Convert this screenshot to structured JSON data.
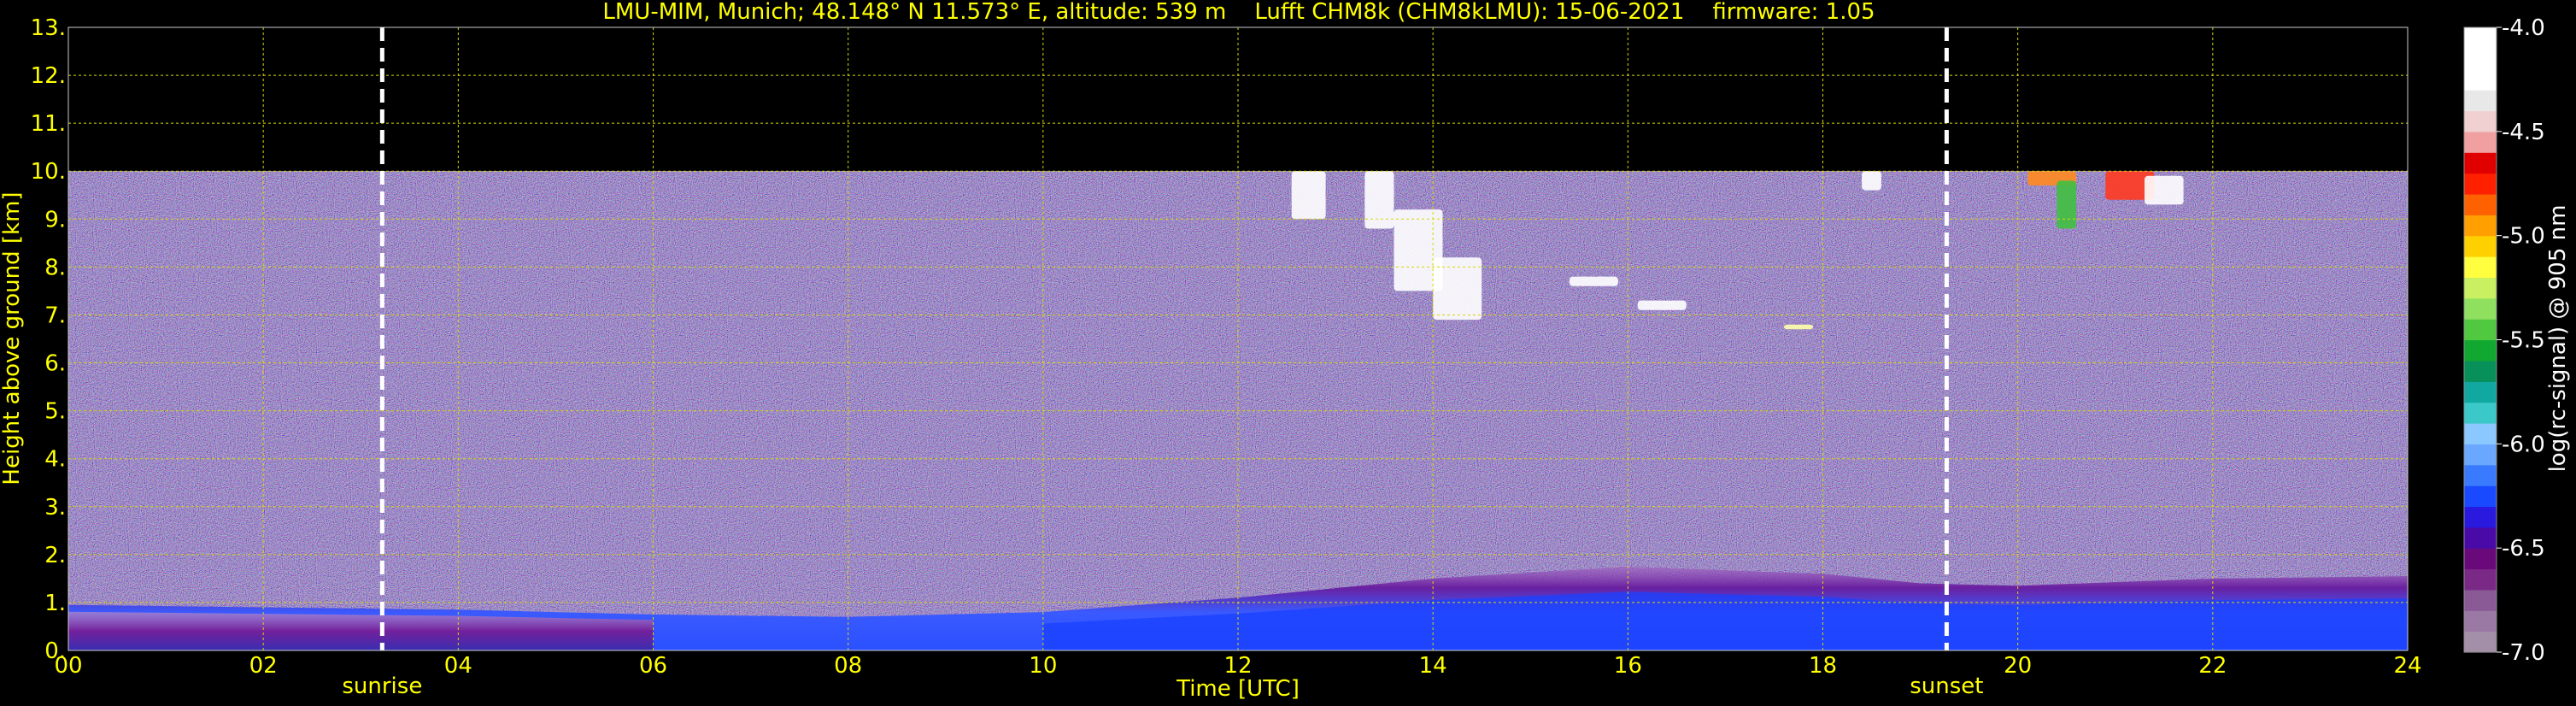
{
  "chart_data": {
    "type": "heatmap",
    "title": "LMU-MIM, Munich; 48.148° N 11.573° E, altitude: 539 m    Lufft CHM8k (CHM8kLMU): 15-06-2021    firmware: 1.05",
    "xlabel": "Time [UTC]",
    "ylabel": "Height above ground [km]",
    "xlim": [
      0,
      24
    ],
    "ylim": [
      0,
      13
    ],
    "x_ticks": [
      {
        "value": 0,
        "label": "00"
      },
      {
        "value": 2,
        "label": "02"
      },
      {
        "value": 4,
        "label": "04"
      },
      {
        "value": 6,
        "label": "06"
      },
      {
        "value": 8,
        "label": "08"
      },
      {
        "value": 10,
        "label": "10"
      },
      {
        "value": 12,
        "label": "12"
      },
      {
        "value": 14,
        "label": "14"
      },
      {
        "value": 16,
        "label": "16"
      },
      {
        "value": 18,
        "label": "18"
      },
      {
        "value": 20,
        "label": "20"
      },
      {
        "value": 22,
        "label": "22"
      },
      {
        "value": 24,
        "label": "24"
      }
    ],
    "y_ticks": [
      {
        "value": 0,
        "label": "0."
      },
      {
        "value": 1,
        "label": "1."
      },
      {
        "value": 2,
        "label": "2."
      },
      {
        "value": 3,
        "label": "3."
      },
      {
        "value": 4,
        "label": "4."
      },
      {
        "value": 5,
        "label": "5."
      },
      {
        "value": 6,
        "label": "6."
      },
      {
        "value": 7,
        "label": "7."
      },
      {
        "value": 8,
        "label": "8."
      },
      {
        "value": 9,
        "label": "9."
      },
      {
        "value": 10,
        "label": "10."
      },
      {
        "value": 11,
        "label": "11."
      },
      {
        "value": 12,
        "label": "12."
      },
      {
        "value": 13,
        "label": "13."
      }
    ],
    "grid": true,
    "data_top_km": 10,
    "events": [
      {
        "label": "sunrise",
        "time": 3.22
      },
      {
        "label": "sunset",
        "time": 19.27
      }
    ],
    "colorbar": {
      "label": "log(rc-signal) @ 905 nm",
      "range": [
        -7.0,
        -4.0
      ],
      "ticks": [
        {
          "value": -4.0,
          "label": "-4.0"
        },
        {
          "value": -4.5,
          "label": "-4.5"
        },
        {
          "value": -5.0,
          "label": "-5.0"
        },
        {
          "value": -5.5,
          "label": "-5.5"
        },
        {
          "value": -6.0,
          "label": "-6.0"
        },
        {
          "value": -6.5,
          "label": "-6.5"
        },
        {
          "value": -7.0,
          "label": "-7.0"
        }
      ],
      "colors": [
        "#a48fa8",
        "#9a7aa4",
        "#8a5a96",
        "#7a2a86",
        "#6a0a7a",
        "#4a0aa8",
        "#2a1ae0",
        "#1a4aff",
        "#3a7aff",
        "#6aa8ff",
        "#8ac8ff",
        "#3ac8c8",
        "#10a8a0",
        "#08905a",
        "#10a830",
        "#50c840",
        "#90e060",
        "#c8f060",
        "#ffff40",
        "#ffd000",
        "#ffa000",
        "#ff6000",
        "#ff2000",
        "#e00000",
        "#f0a0a0",
        "#f0d0d0",
        "#e8e8e8",
        "#ffffff",
        "#ffffff",
        "#ffffff"
      ]
    },
    "boundary_layer_top_km": [
      {
        "time": 0,
        "value": 0.95
      },
      {
        "time": 2,
        "value": 0.9
      },
      {
        "time": 4,
        "value": 0.85
      },
      {
        "time": 6,
        "value": 0.75
      },
      {
        "time": 8,
        "value": 0.7
      },
      {
        "time": 10,
        "value": 0.8
      },
      {
        "time": 12,
        "value": 1.1
      },
      {
        "time": 14,
        "value": 1.5
      },
      {
        "time": 16,
        "value": 1.75
      },
      {
        "time": 18,
        "value": 1.6
      },
      {
        "time": 19,
        "value": 1.4
      },
      {
        "time": 20,
        "value": 1.35
      },
      {
        "time": 22,
        "value": 1.5
      },
      {
        "time": 24,
        "value": 1.55
      }
    ],
    "cloud_features": [
      {
        "t0": 12.55,
        "t1": 12.9,
        "h0": 9.0,
        "h1": 10.0,
        "color": "#ffffff"
      },
      {
        "t0": 13.3,
        "t1": 13.6,
        "h0": 8.8,
        "h1": 10.0,
        "color": "#ffffff"
      },
      {
        "t0": 13.6,
        "t1": 14.1,
        "h0": 7.5,
        "h1": 9.2,
        "color": "#ffffff"
      },
      {
        "t0": 14.0,
        "t1": 14.5,
        "h0": 6.9,
        "h1": 8.2,
        "color": "#ffffff"
      },
      {
        "t0": 15.4,
        "t1": 15.9,
        "h0": 7.6,
        "h1": 7.8,
        "color": "#ffffff"
      },
      {
        "t0": 16.1,
        "t1": 16.6,
        "h0": 7.1,
        "h1": 7.3,
        "color": "#ffffff"
      },
      {
        "t0": 17.6,
        "t1": 17.9,
        "h0": 6.7,
        "h1": 6.8,
        "color": "#ffffaa"
      },
      {
        "t0": 18.4,
        "t1": 18.6,
        "h0": 9.6,
        "h1": 10.0,
        "color": "#ffffff"
      },
      {
        "t0": 20.1,
        "t1": 20.6,
        "h0": 9.7,
        "h1": 10.0,
        "color": "#ff8a20"
      },
      {
        "t0": 20.4,
        "t1": 20.6,
        "h0": 8.8,
        "h1": 9.8,
        "color": "#40c040"
      },
      {
        "t0": 20.9,
        "t1": 21.4,
        "h0": 9.4,
        "h1": 10.0,
        "color": "#ff3a20"
      },
      {
        "t0": 21.3,
        "t1": 21.7,
        "h0": 9.3,
        "h1": 9.9,
        "color": "#ffffff"
      }
    ]
  }
}
